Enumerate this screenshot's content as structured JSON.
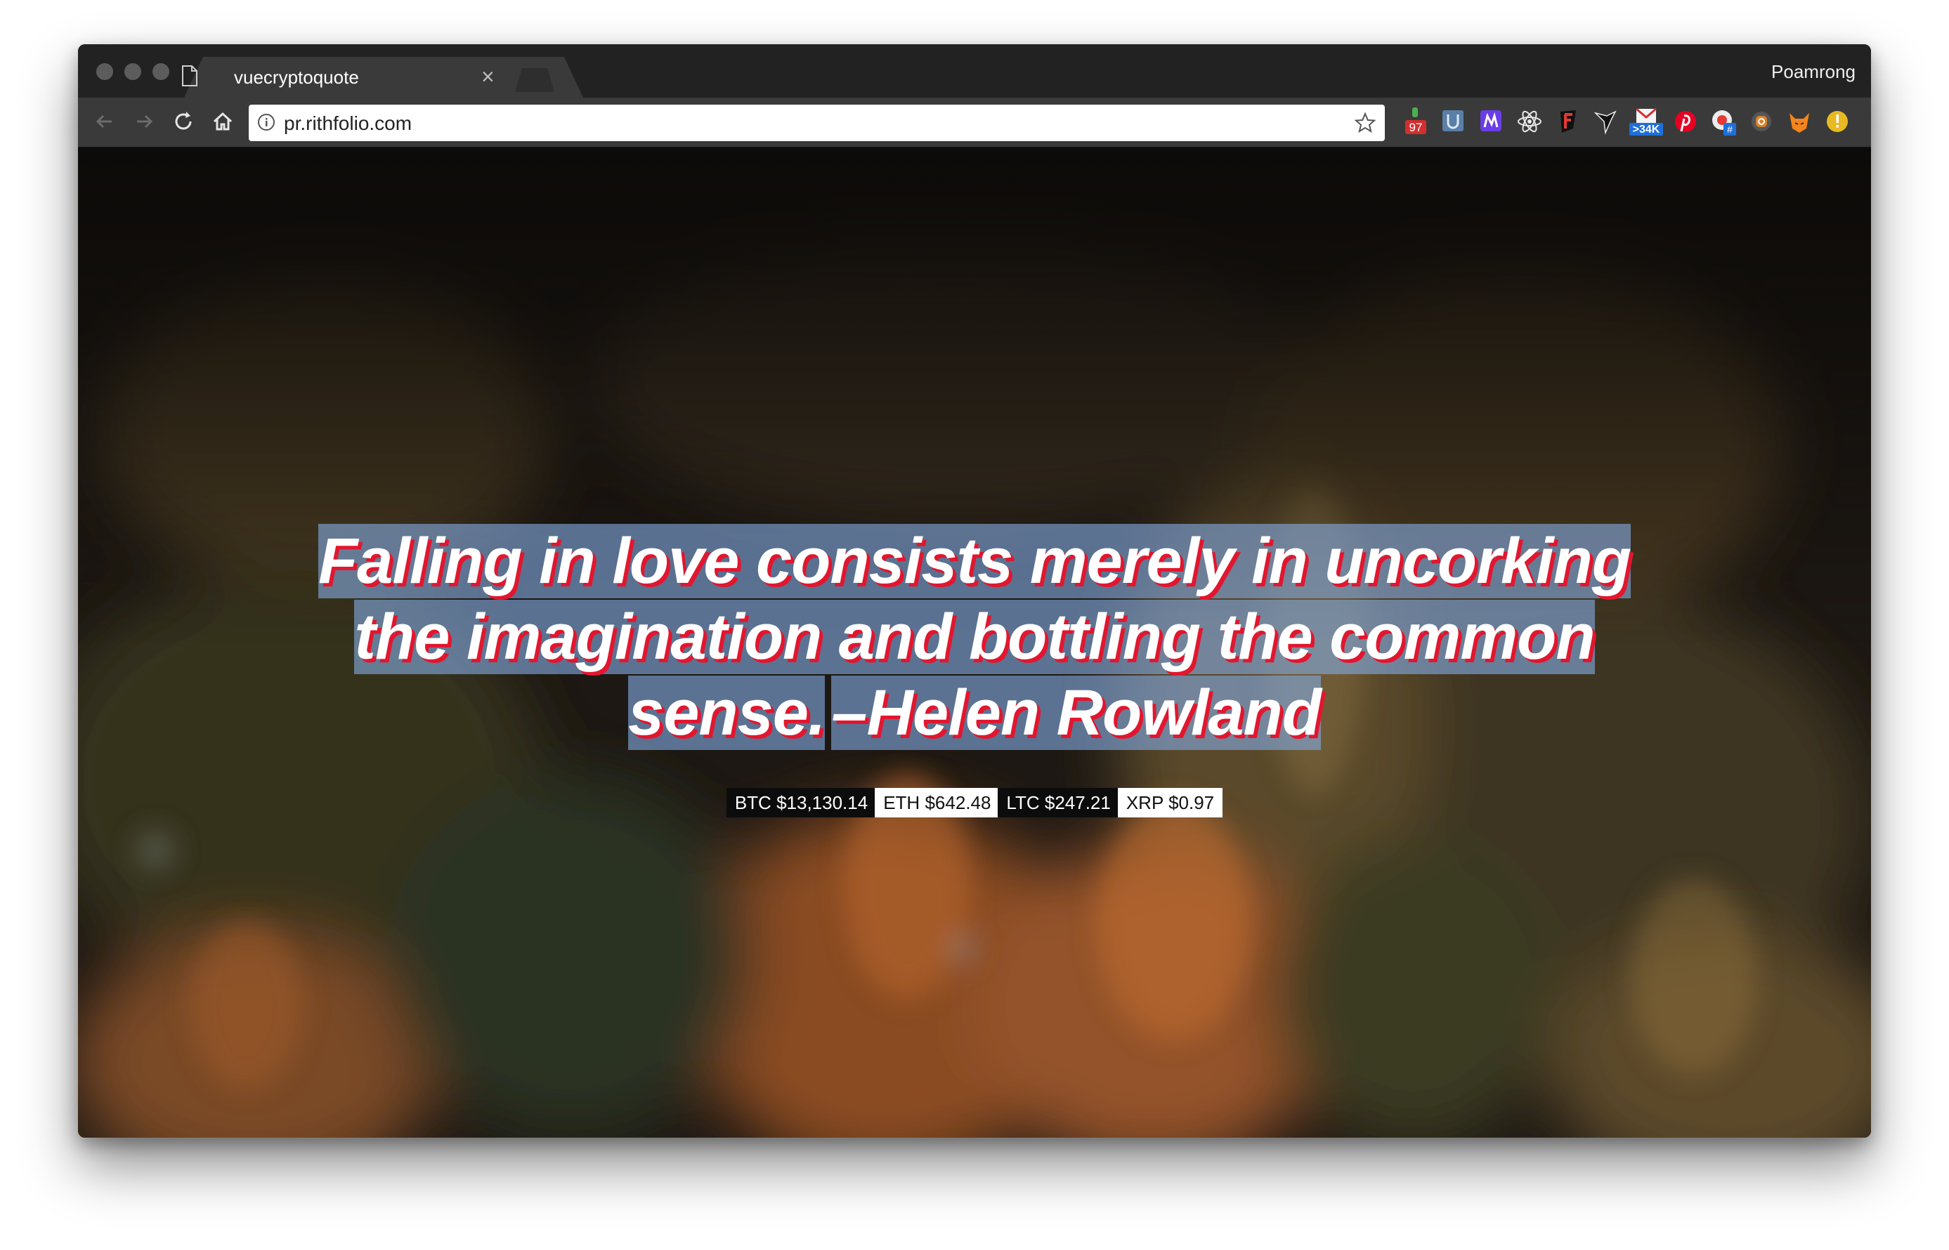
{
  "window": {
    "tab_title": "vuecryptoquote",
    "profile_name": "Poamrong"
  },
  "toolbar": {
    "url": "pr.rithfolio.com",
    "extensions": [
      {
        "name": "counter-extension-icon",
        "badge": "97"
      },
      {
        "name": "u-extension-icon",
        "badge": ""
      },
      {
        "name": "m-extension-icon",
        "badge": ""
      },
      {
        "name": "react-extension-icon",
        "badge": ""
      },
      {
        "name": "f-extension-icon",
        "badge": ""
      },
      {
        "name": "bird-extension-icon",
        "badge": ""
      },
      {
        "name": "mail-extension-icon",
        "badge": ">34K"
      },
      {
        "name": "pinterest-icon",
        "badge": ""
      },
      {
        "name": "hashtag-extension-icon",
        "badge": "#"
      },
      {
        "name": "instagram-icon",
        "badge": ""
      },
      {
        "name": "fox-extension-icon",
        "badge": ""
      },
      {
        "name": "alert-extension-icon",
        "badge": ""
      }
    ]
  },
  "quote": {
    "lines": [
      "Falling in love consists merely in uncorking",
      "the imagination and bottling the common",
      "sense."
    ],
    "author": "–Helen Rowland"
  },
  "prices": [
    {
      "symbol": "BTC",
      "price": "$13,130.14",
      "style": "dark"
    },
    {
      "symbol": "ETH",
      "price": "$642.48",
      "style": "light"
    },
    {
      "symbol": "LTC",
      "price": "$247.21",
      "style": "dark"
    },
    {
      "symbol": "XRP",
      "price": "$0.97",
      "style": "light"
    }
  ],
  "colors": {
    "highlight": "#82aae1",
    "quote_shadow": "#e2162f",
    "chrome_dark": "#222222",
    "chrome_toolbar": "#3a3a3a"
  }
}
